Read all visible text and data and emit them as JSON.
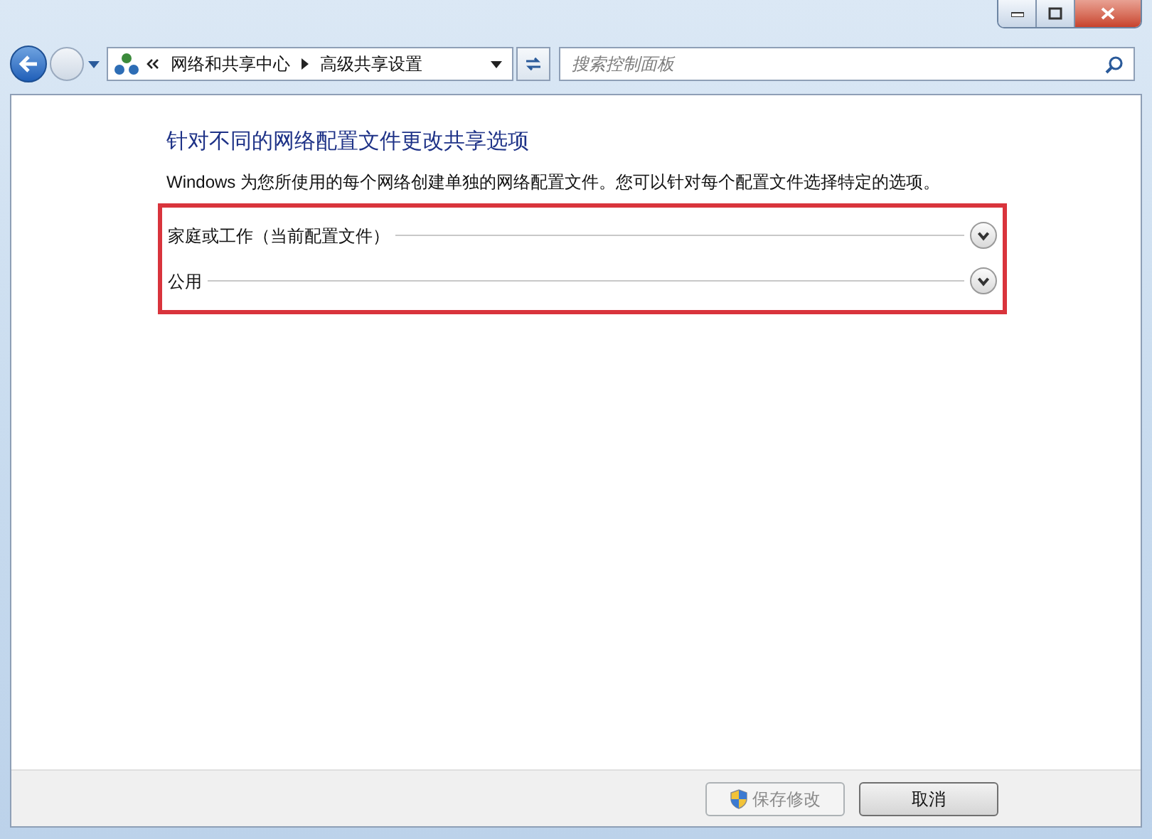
{
  "address_bar": {
    "breadcrumbs": [
      "网络和共享中心",
      "高级共享设置"
    ]
  },
  "search": {
    "placeholder": "搜索控制面板"
  },
  "heading": "针对不同的网络配置文件更改共享选项",
  "description": "Windows 为您所使用的每个网络创建单独的网络配置文件。您可以针对每个配置文件选择特定的选项。",
  "profiles": [
    {
      "label": "家庭或工作（当前配置文件）",
      "expanded": false
    },
    {
      "label": "公用",
      "expanded": false
    }
  ],
  "buttons": [
    {
      "label": "保存修改",
      "kind": "shield",
      "disabled": true
    },
    {
      "label": "取消",
      "kind": "plain",
      "disabled": false
    }
  ]
}
